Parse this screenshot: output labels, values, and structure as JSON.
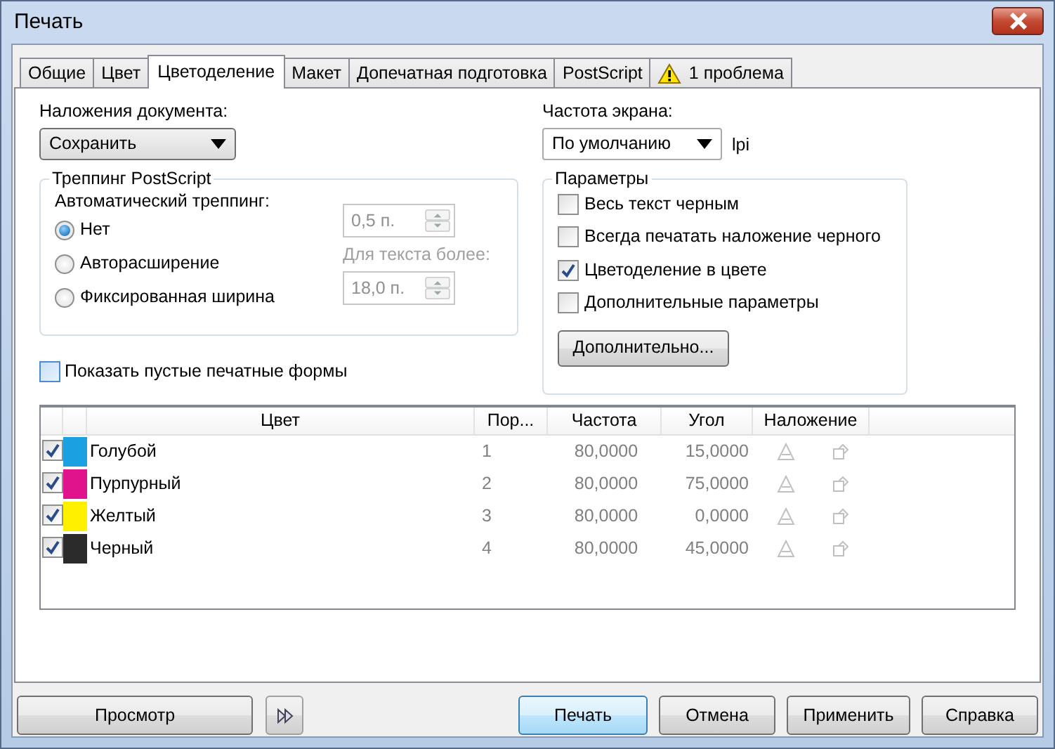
{
  "window": {
    "title": "Печать"
  },
  "tabs": [
    {
      "label": "Общие",
      "selected": false,
      "kind": "plain"
    },
    {
      "label": "Цвет",
      "selected": false,
      "kind": "plain"
    },
    {
      "label": "Цветоделение",
      "selected": true,
      "kind": "plain"
    },
    {
      "label": "Макет",
      "selected": false,
      "kind": "plain"
    },
    {
      "label": "Допечатная подготовка",
      "selected": false,
      "kind": "plain"
    },
    {
      "label": "PostScript",
      "selected": false,
      "kind": "plain"
    },
    {
      "label": "1 проблема",
      "selected": false,
      "kind": "warning"
    }
  ],
  "document_overprint": {
    "label": "Наложения документа:",
    "value": "Сохранить"
  },
  "screen_frequency": {
    "label": "Частота экрана:",
    "value": "По умолчанию",
    "unit": "lpi"
  },
  "trapping": {
    "title": "Треппинг PostScript",
    "subtitle": "Автоматический треппинг:",
    "options": [
      {
        "label": "Нет",
        "selected": true
      },
      {
        "label": "Авторасширение",
        "selected": false
      },
      {
        "label": "Фиксированная ширина",
        "selected": false
      }
    ],
    "fields": [
      {
        "value": "0,5 п.",
        "disabled": true
      },
      {
        "label": "Для текста более:",
        "value": "18,0 п.",
        "disabled": true
      }
    ]
  },
  "parameters": {
    "title": "Параметры",
    "checkboxes": [
      {
        "label": "Весь текст черным",
        "checked": false
      },
      {
        "label": "Всегда печатать наложение черного",
        "checked": false
      },
      {
        "label": "Цветоделение в цвете",
        "checked": true
      },
      {
        "label": "Дополнительные параметры",
        "checked": false
      }
    ],
    "button": "Дополнительно..."
  },
  "show_empty_plates": {
    "label": "Показать пустые печатные формы",
    "checked": false
  },
  "separations": {
    "columns": [
      "Цвет",
      "Пор...",
      "Частота",
      "Угол",
      "Наложение"
    ],
    "rows": [
      {
        "printed": true,
        "color": "#1ba1e2",
        "name": "Голубой",
        "order": "1",
        "frequency": "80,0000",
        "angle": "15,0000"
      },
      {
        "printed": true,
        "color": "#e0138c",
        "name": "Пурпурный",
        "order": "2",
        "frequency": "80,0000",
        "angle": "75,0000"
      },
      {
        "printed": true,
        "color": "#fff000",
        "name": "Желтый",
        "order": "3",
        "frequency": "80,0000",
        "angle": "0,0000"
      },
      {
        "printed": true,
        "color": "#2b2b2b",
        "name": "Черный",
        "order": "4",
        "frequency": "80,0000",
        "angle": "45,0000"
      }
    ]
  },
  "footer_buttons": [
    {
      "label": "Просмотр",
      "kind": "wide"
    },
    {
      "kind": "icon"
    },
    {
      "label": "Печать",
      "kind": "default"
    },
    {
      "label": "Отмена",
      "kind": "normal"
    },
    {
      "label": "Применить",
      "kind": "normal"
    },
    {
      "label": "Справка",
      "kind": "normal"
    }
  ]
}
